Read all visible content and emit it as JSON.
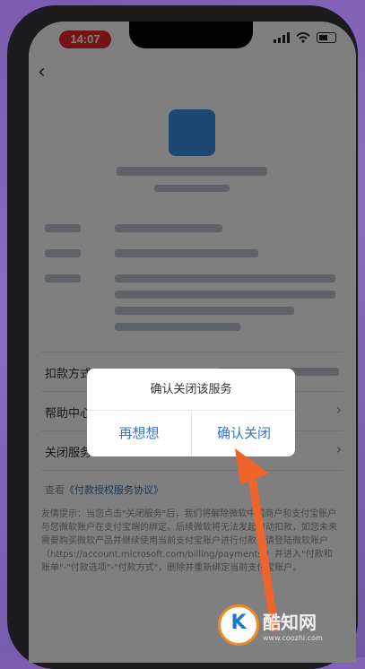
{
  "status_bar": {
    "time": "14:07"
  },
  "labels": {
    "deduction_method": "扣款方式",
    "help_center": "帮助中心",
    "close_service": "关闭服务",
    "agreement_prefix": "查看",
    "agreement_link": "《付款授权服务协议》"
  },
  "notice": {
    "text": "友情提示：当您点击\"关闭服务\"后，我们将解除微软中国商户和支付宝账户与您微软账户在支付宝端的绑定。后续微软将无法发起自动扣款，如您未来需要购买微软产品并继续使用当前支付宝账户进行付款，请登陆微软账户（https://account.microsoft.com/billing/payments/）并进入\"付款和账单\"-\"付款选项\"-\"付款方式\"，删除并重新绑定当前支付宝账户。"
  },
  "dialog": {
    "message": "确认关闭该服务",
    "cancel_label": "再想想",
    "confirm_label": "确认关闭"
  },
  "watermark": {
    "title": "酷知网",
    "url": "www.coozhi.com"
  },
  "colors": {
    "accent": "#2f76c9",
    "arrow": "#f0632a",
    "time_pill": "#e8292d"
  }
}
